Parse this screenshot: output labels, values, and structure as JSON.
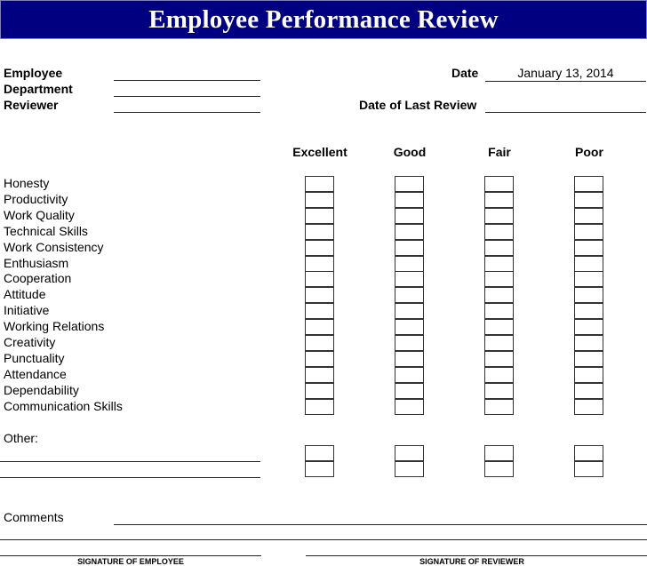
{
  "header": {
    "title": "Employee Performance Review",
    "bg_color": "#000080"
  },
  "fields_left": [
    {
      "label": "Employee",
      "value": ""
    },
    {
      "label": "Department",
      "value": ""
    },
    {
      "label": "Reviewer",
      "value": ""
    }
  ],
  "fields_right": [
    {
      "label": "Date",
      "value": "January 13, 2014"
    },
    {
      "label": "Date of Last Review",
      "value": ""
    }
  ],
  "rating_columns": [
    "Excellent",
    "Good",
    "Fair",
    "Poor"
  ],
  "criteria": [
    "Honesty",
    "Productivity",
    "Work Quality",
    "Technical Skills",
    "Work Consistency",
    "Enthusiasm",
    "Cooperation",
    "Attitude",
    "Initiative",
    "Working Relations",
    "Creativity",
    "Punctuality",
    "Attendance",
    "Dependability",
    "Communication Skills"
  ],
  "other": {
    "label": "Other:",
    "rows": 2
  },
  "comments": {
    "label": "Comments"
  },
  "signatures": {
    "employee": "SIGNATURE OF EMPLOYEE",
    "reviewer": "SIGNATURE OF REVIEWER"
  }
}
